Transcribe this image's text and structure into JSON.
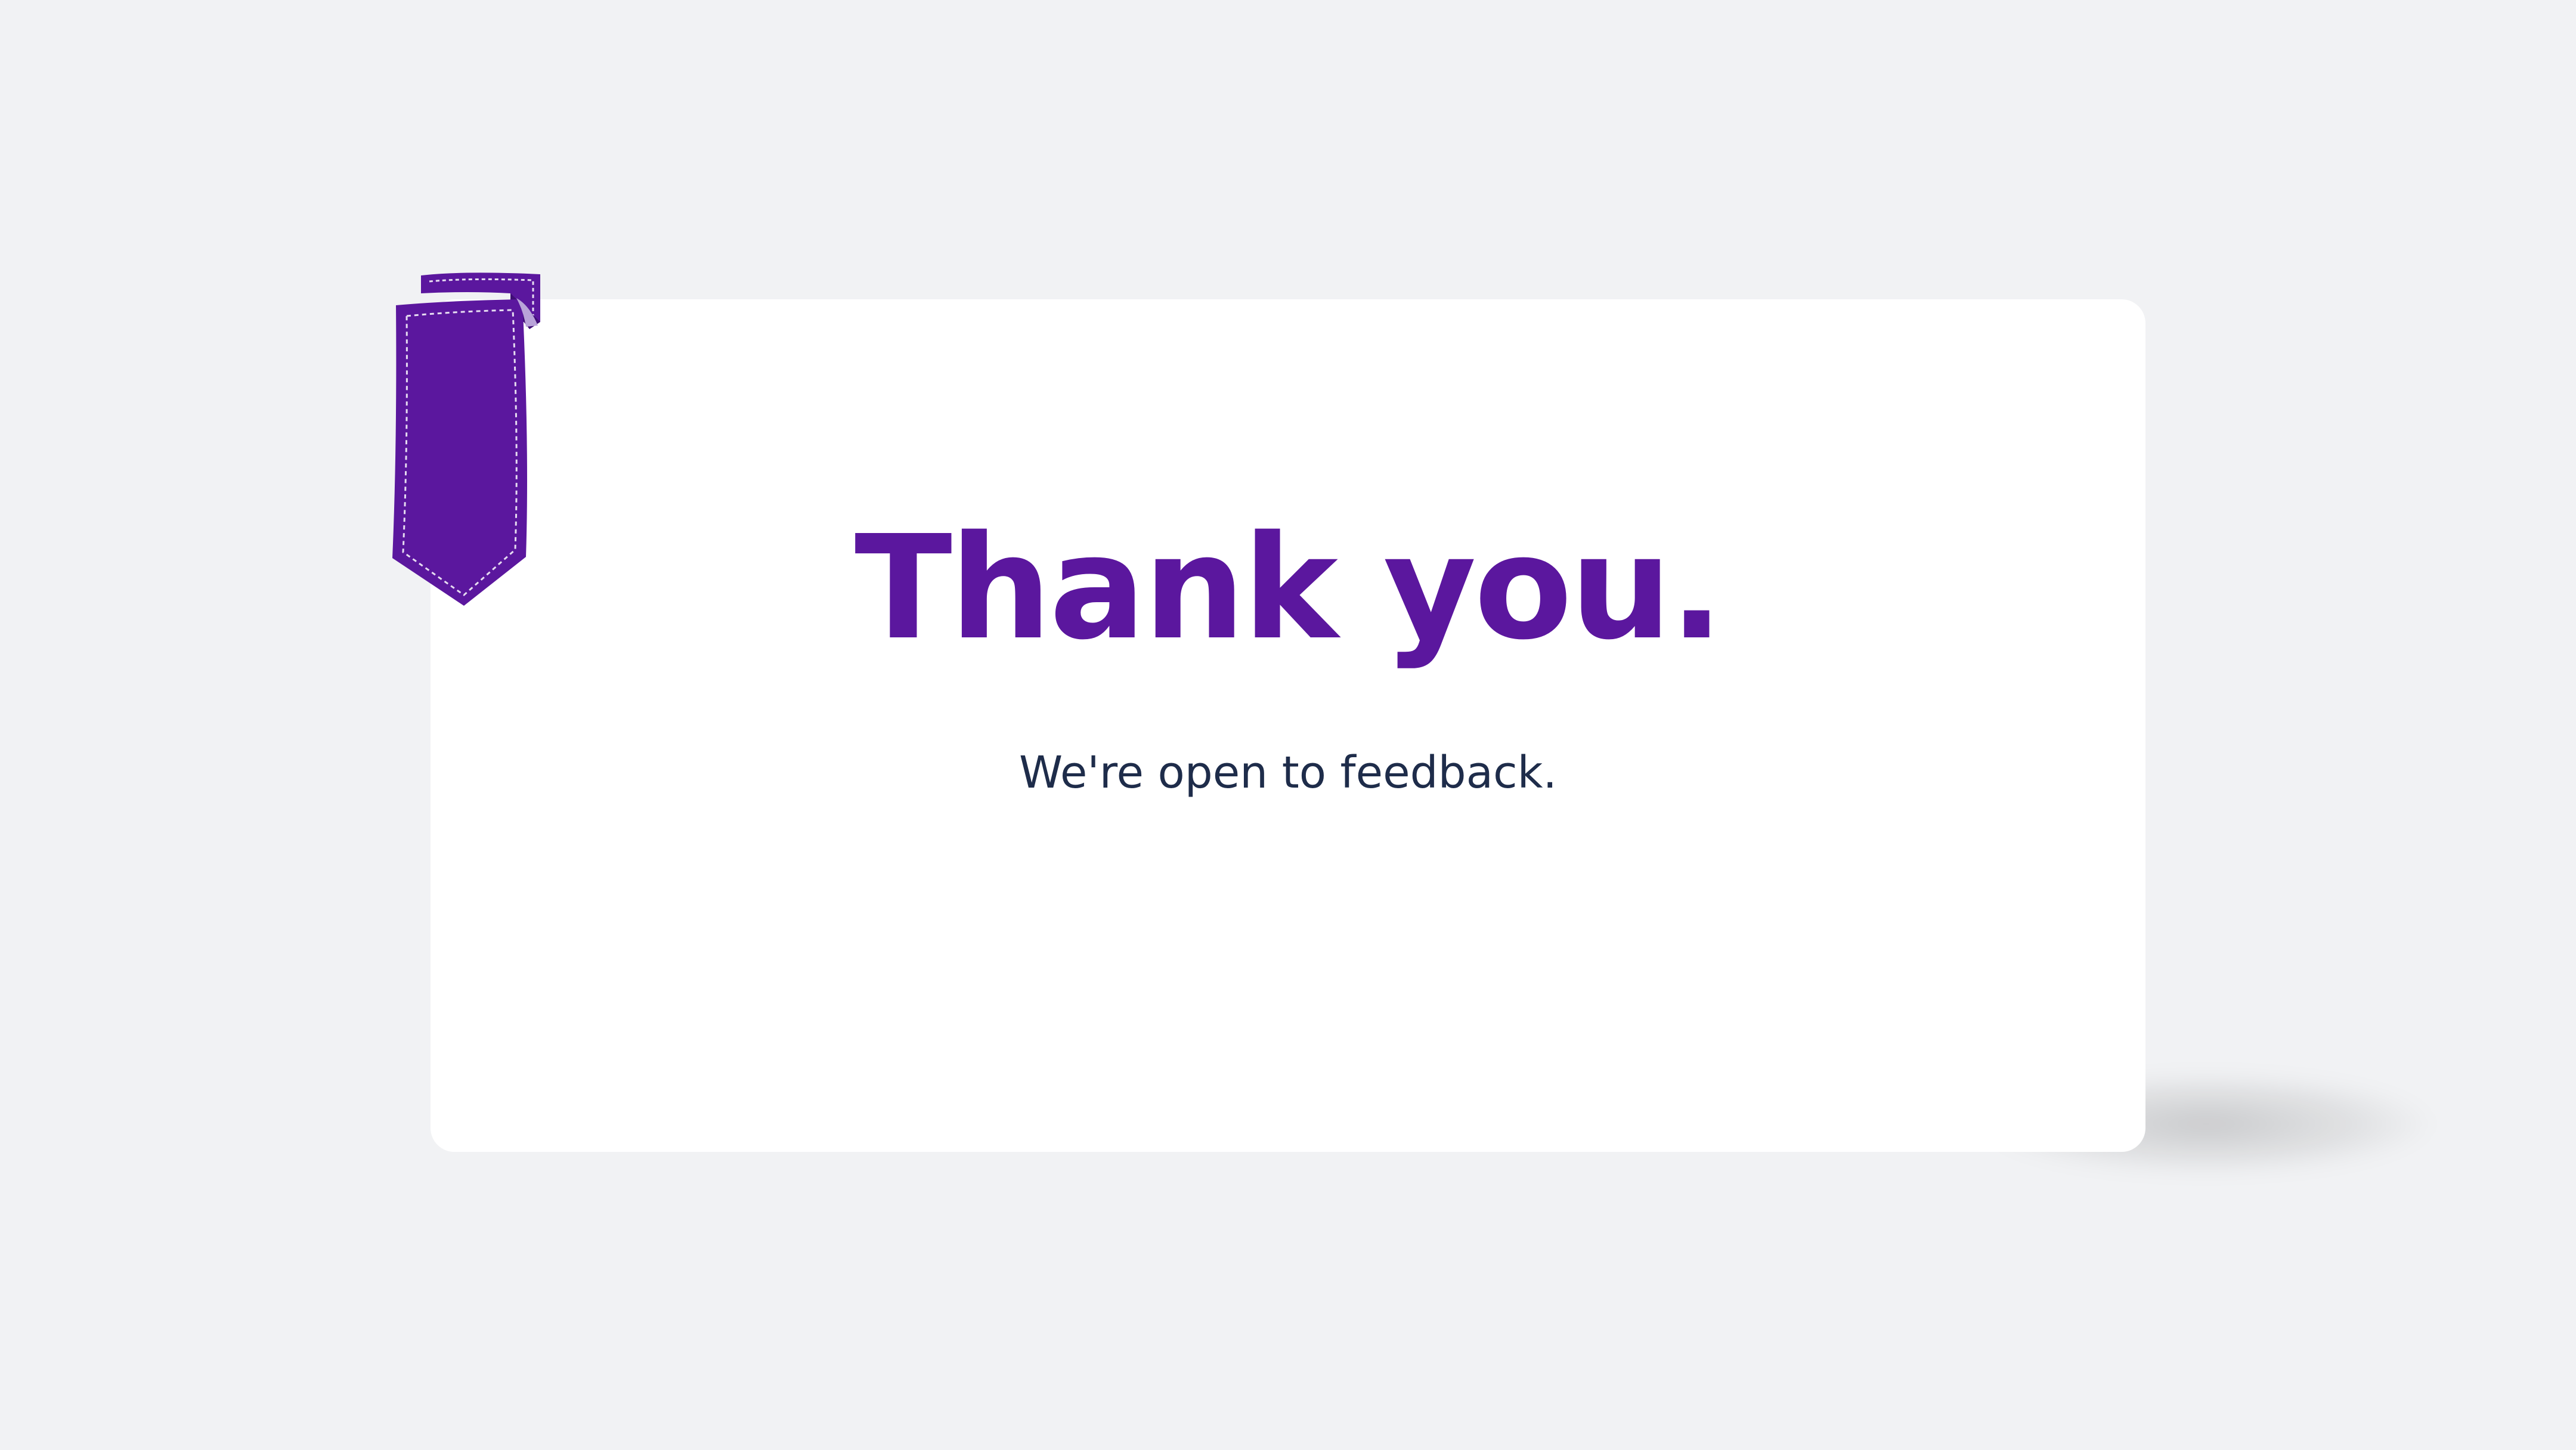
{
  "slide": {
    "title": "Thank you.",
    "subtitle": "We're open to feedback."
  },
  "icons": {
    "ribbon": "bookmark-ribbon-icon"
  },
  "colors": {
    "background": "#f1f2f4",
    "card": "#ffffff",
    "accent": "#5b179e",
    "text_dark": "#1e2c4a"
  }
}
